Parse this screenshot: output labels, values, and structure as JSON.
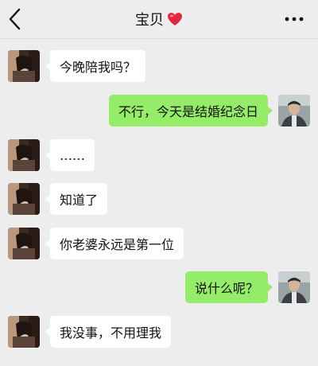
{
  "header": {
    "title": "宝贝",
    "title_emoji_icon": "heart-icon",
    "back_icon": "chevron-left-icon",
    "more_icon": "more-dots-icon"
  },
  "colors": {
    "background": "#ededed",
    "incoming_bubble": "#ffffff",
    "outgoing_bubble": "#95ec69",
    "heart": "#e0283f"
  },
  "messages": [
    {
      "side": "left",
      "text": "今晚陪我吗？"
    },
    {
      "side": "right",
      "text": "不行，今天是结婚纪念日"
    },
    {
      "side": "left",
      "text": "……"
    },
    {
      "side": "left",
      "text": "知道了"
    },
    {
      "side": "left",
      "text": "你老婆永远是第一位"
    },
    {
      "side": "right",
      "text": "说什么呢？"
    },
    {
      "side": "left",
      "text": "我没事，不用理我"
    }
  ]
}
